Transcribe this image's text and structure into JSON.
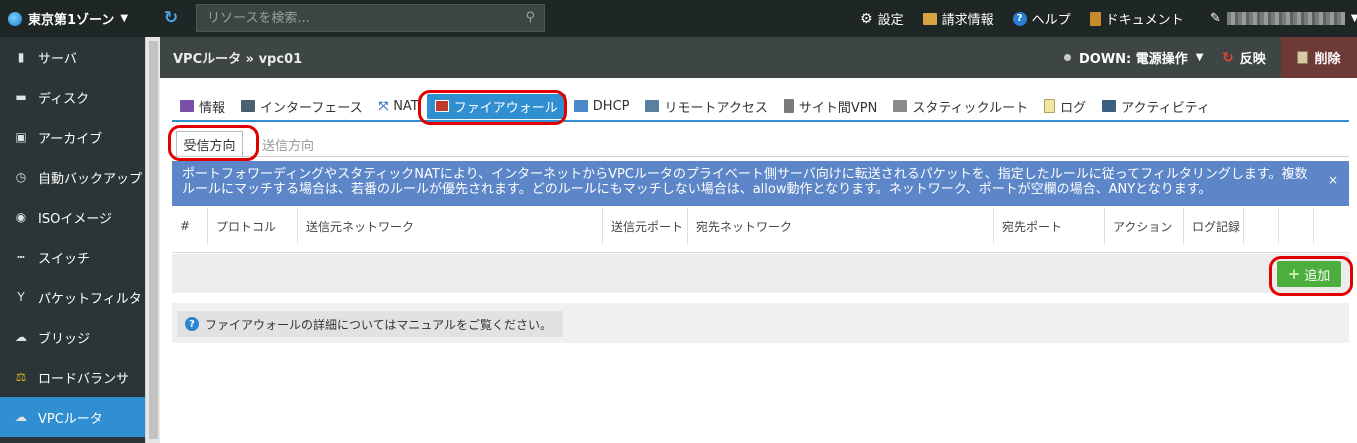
{
  "topbar": {
    "zone": "東京第1ゾーン",
    "search_placeholder": "リソースを検索...",
    "links": [
      {
        "label": "設定",
        "icon": "gear-icon"
      },
      {
        "label": "請求情報",
        "icon": "billing-icon"
      },
      {
        "label": "ヘルプ",
        "icon": "help-icon"
      },
      {
        "label": "ドキュメント",
        "icon": "document-icon"
      }
    ]
  },
  "sidebar": {
    "items": [
      {
        "label": "サーバ",
        "icon": "server-icon"
      },
      {
        "label": "ディスク",
        "icon": "disk-icon"
      },
      {
        "label": "アーカイブ",
        "icon": "archive-icon"
      },
      {
        "label": "自動バックアップ",
        "icon": "clock-icon"
      },
      {
        "label": "ISOイメージ",
        "icon": "cd-icon"
      },
      {
        "label": "スイッチ",
        "icon": "switch-icon"
      },
      {
        "label": "パケットフィルタ",
        "icon": "filter-icon"
      },
      {
        "label": "ブリッジ",
        "icon": "bridge-icon"
      },
      {
        "label": "ロードバランサ",
        "icon": "balance-icon"
      },
      {
        "label": "VPCルータ",
        "icon": "cloud-icon",
        "active": true
      }
    ]
  },
  "header": {
    "breadcrumb": "VPCルータ » vpc01",
    "status": "DOWN: 電源操作",
    "reflect_label": "反映",
    "delete_label": "削除"
  },
  "tabs": [
    {
      "label": "情報",
      "icon": "info-icon"
    },
    {
      "label": "インターフェース",
      "icon": "interface-icon"
    },
    {
      "label": "NAT",
      "icon": "nat-icon"
    },
    {
      "label": "ファイアウォール",
      "icon": "firewall-icon",
      "active": true
    },
    {
      "label": "DHCP",
      "icon": "dhcp-icon"
    },
    {
      "label": "リモートアクセス",
      "icon": "remote-access-icon"
    },
    {
      "label": "サイト間VPN",
      "icon": "site-vpn-icon"
    },
    {
      "label": "スタティックルート",
      "icon": "static-route-icon"
    },
    {
      "label": "ログ",
      "icon": "log-icon"
    },
    {
      "label": "アクティビティ",
      "icon": "activity-icon"
    }
  ],
  "subtabs": {
    "inbound": "受信方向",
    "outbound": "送信方向"
  },
  "banner": {
    "text": "ポートフォワーディングやスタティックNATにより、インターネットからVPCルータのプライベート側サーバ向けに転送されるパケットを、指定したルールに従ってフィルタリングします。複数ルールにマッチする場合は、若番のルールが優先されます。どのルールにもマッチしない場合は、allow動作となります。ネットワーク、ポートが空欄の場合、ANYとなります。",
    "close": "×"
  },
  "table": {
    "columns": [
      "#",
      "プロトコル",
      "送信元ネットワーク",
      "送信元ポート",
      "宛先ネットワーク",
      "宛先ポート",
      "アクション",
      "ログ記録",
      "",
      ""
    ]
  },
  "add_label": "追加",
  "help_text": "ファイアウォールの詳細についてはマニュアルをご覧ください。",
  "colors": {
    "accent": "#2f8fd0",
    "topbar": "#1f2626",
    "sidebar": "#2b3535",
    "banner": "#5c86c8",
    "add": "#4cae3c",
    "highlight": "#e00000"
  }
}
